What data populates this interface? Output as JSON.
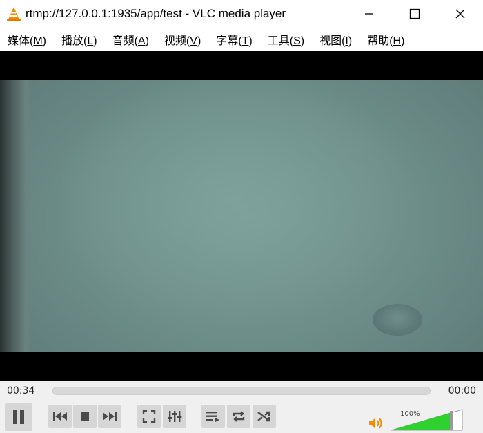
{
  "window": {
    "title": "rtmp://127.0.0.1:1935/app/test - VLC media player",
    "icon": "vlc-cone-icon"
  },
  "menu": {
    "items": [
      {
        "label": "媒体(",
        "key": "M",
        "suffix": ")"
      },
      {
        "label": "播放(",
        "key": "L",
        "suffix": ")"
      },
      {
        "label": "音频(",
        "key": "A",
        "suffix": ")"
      },
      {
        "label": "视频(",
        "key": "V",
        "suffix": ")"
      },
      {
        "label": "字幕(",
        "key": "T",
        "suffix": ")"
      },
      {
        "label": "工具(",
        "key": "S",
        "suffix": ")"
      },
      {
        "label": "视图(",
        "key": "I",
        "suffix": ")"
      },
      {
        "label": "帮助(",
        "key": "H",
        "suffix": ")"
      }
    ]
  },
  "playback": {
    "elapsed": "00:34",
    "total": "00:00",
    "progress": 0
  },
  "volume": {
    "label": "100%",
    "level": 1.0,
    "accent": "#2fd12f"
  },
  "colors": {
    "button_bg": "#d6d6d6",
    "icon": "#4a4a4a"
  }
}
